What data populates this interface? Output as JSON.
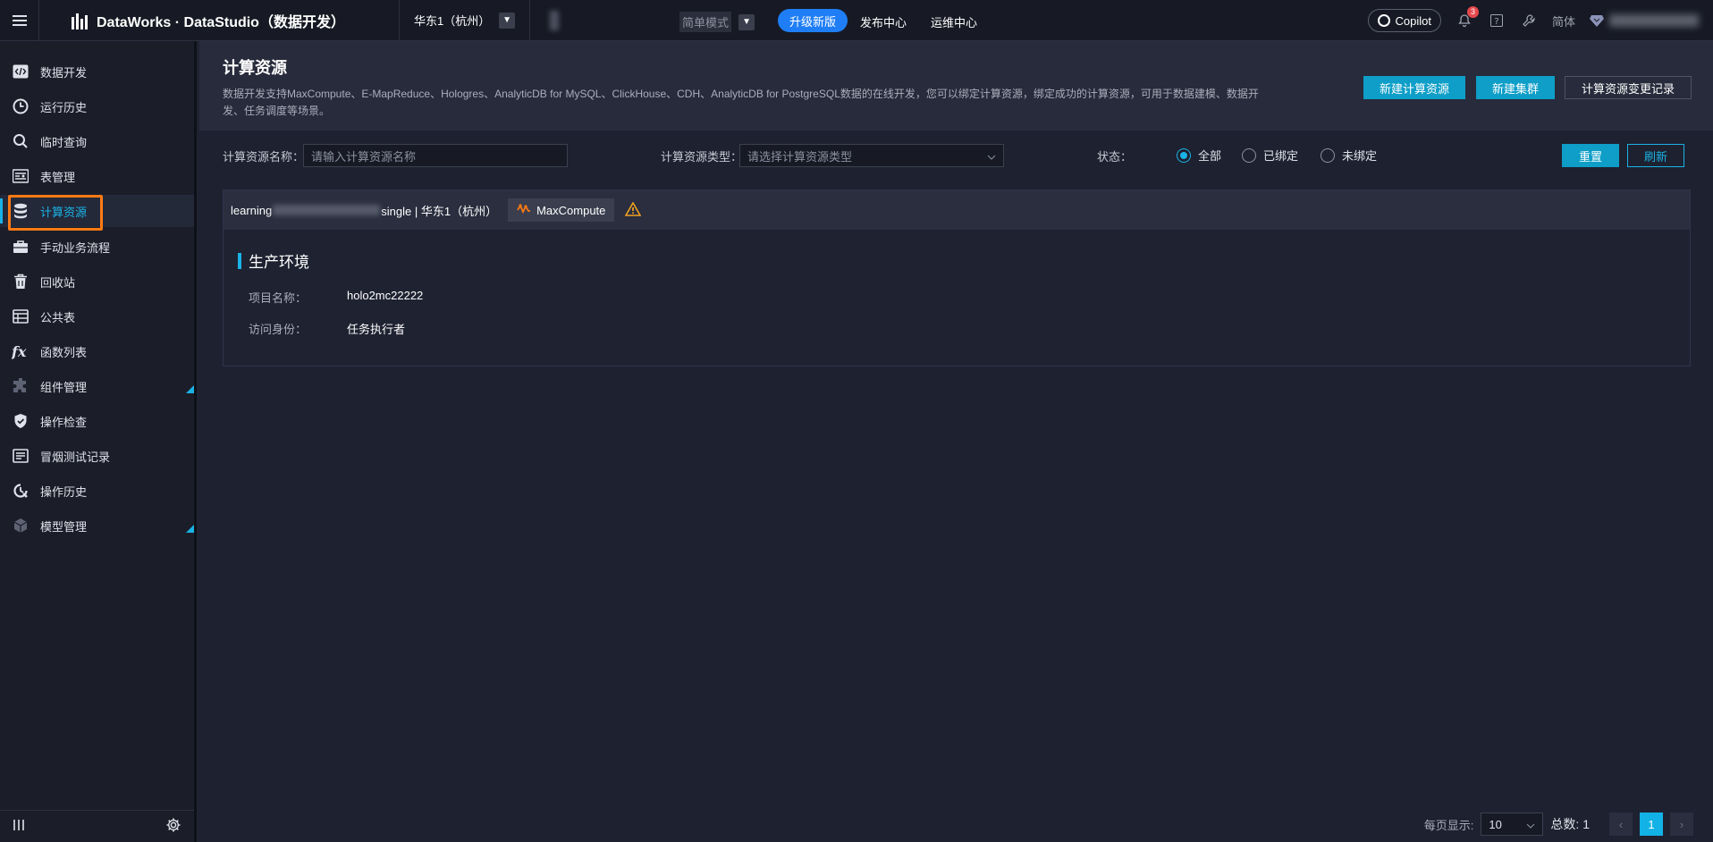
{
  "topbar": {
    "app_title": "DataWorks · DataStudio（数据开发）",
    "region": "华东1（杭州）",
    "mode": "简单模式",
    "upgrade": "升级新版",
    "nav": [
      "发布中心",
      "运维中心"
    ],
    "copilot": "Copilot",
    "notification_count": "3",
    "lang": "简体"
  },
  "sidebar": {
    "items": [
      {
        "label": "数据开发",
        "icon": "code-icon"
      },
      {
        "label": "运行历史",
        "icon": "clock-icon"
      },
      {
        "label": "临时查询",
        "icon": "search-icon"
      },
      {
        "label": "表管理",
        "icon": "table-manage-icon"
      },
      {
        "label": "计算资源",
        "icon": "database-icon"
      },
      {
        "label": "手动业务流程",
        "icon": "briefcase-icon"
      },
      {
        "label": "回收站",
        "icon": "trash-icon"
      },
      {
        "label": "公共表",
        "icon": "grid-table-icon"
      },
      {
        "label": "函数列表",
        "icon": "function-icon"
      },
      {
        "label": "组件管理",
        "icon": "puzzle-icon"
      },
      {
        "label": "操作检查",
        "icon": "shield-check-icon"
      },
      {
        "label": "冒烟测试记录",
        "icon": "test-log-icon"
      },
      {
        "label": "操作历史",
        "icon": "history-icon"
      },
      {
        "label": "模型管理",
        "icon": "cube-icon"
      }
    ],
    "active_index": 4
  },
  "page": {
    "title": "计算资源",
    "description": "数据开发支持MaxCompute、E-MapReduce、Hologres、AnalyticDB for MySQL、ClickHouse、CDH、AnalyticDB for PostgreSQL数据的在线开发，您可以绑定计算资源，绑定成功的计算资源，可用于数据建模、数据开发、任务调度等场景。",
    "buttons": {
      "new_resource": "新建计算资源",
      "new_cluster": "新建集群",
      "change_log": "计算资源变更记录"
    }
  },
  "filters": {
    "name_label": "计算资源名称：",
    "name_placeholder": "请输入计算资源名称",
    "type_label": "计算资源类型：",
    "type_placeholder": "请选择计算资源类型",
    "status_label": "状态：",
    "status_options": [
      "全部",
      "已绑定",
      "未绑定"
    ],
    "status_selected": "全部",
    "reset": "重置",
    "refresh": "刷新"
  },
  "card": {
    "name_prefix": "learning",
    "name_suffix": "single | 华东1（杭州）",
    "engine": "MaxCompute",
    "env_title": "生产环境",
    "fields": [
      {
        "key": "项目名称：",
        "value": "holo2mc22222"
      },
      {
        "key": "访问身份：",
        "value": "任务执行者"
      }
    ]
  },
  "pagination": {
    "page_size_label": "每页显示:",
    "page_size": "10",
    "total": "总数: 1",
    "current_page": "1"
  },
  "colors": {
    "accent": "#1ab3e6",
    "primary_button": "#0e9ec7",
    "highlight": "#ff7a14",
    "warning": "#f0a020"
  }
}
